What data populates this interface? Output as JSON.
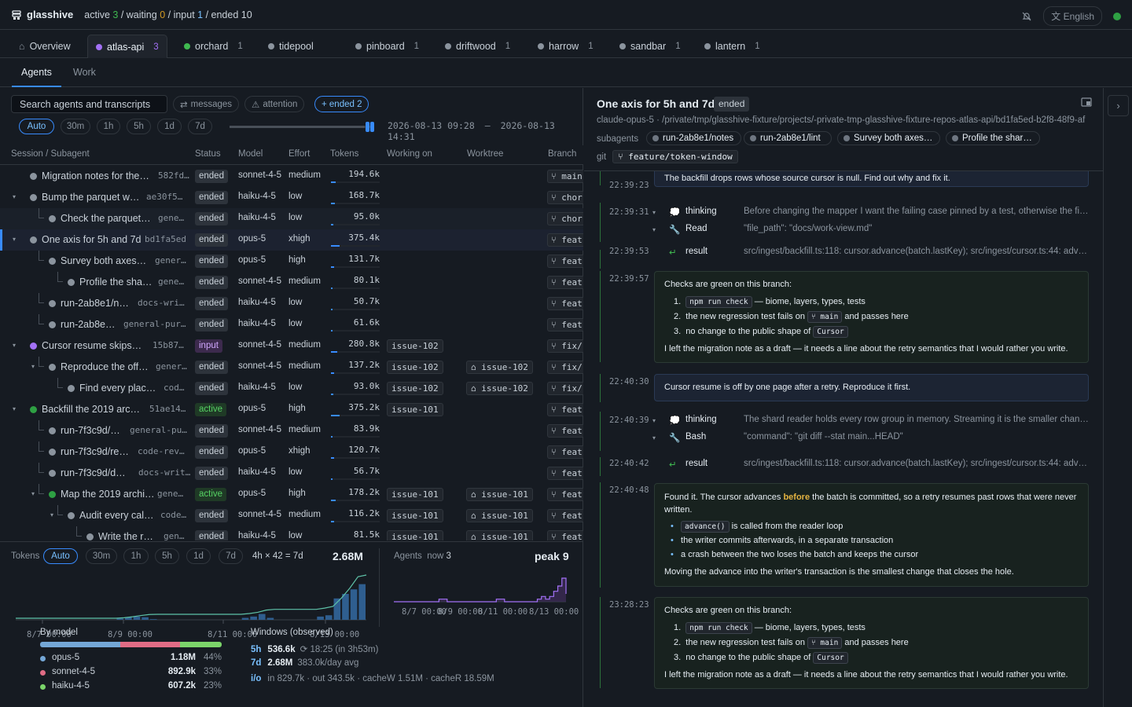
{
  "app": {
    "name": "glasshive"
  },
  "status_counts": {
    "active_label": "active",
    "active": "3",
    "waiting_label": "waiting",
    "waiting": "0",
    "input_label": "input",
    "input": "1",
    "ended_label": "ended",
    "ended": "10"
  },
  "language": "English",
  "projects": [
    {
      "name": "Overview",
      "count": "",
      "icon": "home-icon"
    },
    {
      "name": "atlas-api",
      "count": "3"
    },
    {
      "name": "orchard",
      "count": "1"
    },
    {
      "name": "tidepool",
      "count": ""
    },
    {
      "name": "pinboard",
      "count": "1"
    },
    {
      "name": "driftwood",
      "count": "1"
    },
    {
      "name": "harrow",
      "count": "1"
    },
    {
      "name": "sandbar",
      "count": "1"
    },
    {
      "name": "lantern",
      "count": "1"
    }
  ],
  "subtabs": [
    "Agents",
    "Work"
  ],
  "filters": {
    "search_placeholder": "Search agents and transcripts",
    "messages": "messages",
    "attention": "attention",
    "ended": "+ ended 2"
  },
  "ranges": [
    "Auto",
    "30m",
    "1h",
    "5h",
    "1d",
    "7d"
  ],
  "range_text": {
    "start": "2026-08-13 09:28",
    "sep": "–",
    "end": "2026-08-13 14:31"
  },
  "columns": [
    "Session / Subagent",
    "Status",
    "Model",
    "Effort",
    "Tokens",
    "Working on",
    "Worktree",
    "Branch"
  ],
  "rows": [
    {
      "name": "Migration notes for the…",
      "id": "582fd…",
      "status": "ended",
      "model": "sonnet-4-5",
      "effort": "medium",
      "tokens": "194.6k",
      "tfrac": 0.09,
      "issue": "",
      "worktree": "",
      "branch": "main"
    },
    {
      "name": "Bump the parquet w…",
      "id": "ae30f5…",
      "status": "ended",
      "model": "haiku-4-5",
      "effort": "low",
      "tokens": "168.7k",
      "tfrac": 0.08,
      "issue": "",
      "worktree": "",
      "branch": "chor"
    },
    {
      "name": "Check the parquet…",
      "id": "gene…",
      "status": "ended",
      "model": "haiku-4-5",
      "effort": "low",
      "tokens": "95.0k",
      "tfrac": 0.05,
      "issue": "",
      "worktree": "",
      "branch": "chor"
    },
    {
      "name": "One axis for 5h and 7d",
      "id": "bd1fa5ed",
      "status": "ended",
      "model": "opus-5",
      "effort": "xhigh",
      "tokens": "375.4k",
      "tfrac": 0.18,
      "issue": "",
      "worktree": "",
      "branch": "feat"
    },
    {
      "name": "Survey both axes…",
      "id": "gener…",
      "status": "ended",
      "model": "opus-5",
      "effort": "high",
      "tokens": "131.7k",
      "tfrac": 0.06,
      "issue": "",
      "worktree": "",
      "branch": "feat"
    },
    {
      "name": "Profile the sha…",
      "id": "gene…",
      "status": "ended",
      "model": "sonnet-4-5",
      "effort": "medium",
      "tokens": "80.1k",
      "tfrac": 0.04,
      "issue": "",
      "worktree": "",
      "branch": "feat"
    },
    {
      "name": "run-2ab8e1/n…",
      "id": "docs-wri…",
      "status": "ended",
      "model": "haiku-4-5",
      "effort": "low",
      "tokens": "50.7k",
      "tfrac": 0.03,
      "issue": "",
      "worktree": "",
      "branch": "feat"
    },
    {
      "name": "run-2ab8e…",
      "id": "general-pur…",
      "status": "ended",
      "model": "haiku-4-5",
      "effort": "low",
      "tokens": "61.6k",
      "tfrac": 0.03,
      "issue": "",
      "worktree": "",
      "branch": "feat"
    },
    {
      "name": "Cursor resume skips…",
      "id": "15b87…",
      "status": "input",
      "model": "sonnet-4-5",
      "effort": "medium",
      "tokens": "280.8k",
      "tfrac": 0.13,
      "issue": "issue-102",
      "worktree": "",
      "branch": "fix/"
    },
    {
      "name": "Reproduce the off…",
      "id": "gener…",
      "status": "ended",
      "model": "sonnet-4-5",
      "effort": "medium",
      "tokens": "137.2k",
      "tfrac": 0.07,
      "issue": "issue-102",
      "worktree": "issue-102",
      "branch": "fix/"
    },
    {
      "name": "Find every plac…",
      "id": "cod…",
      "status": "ended",
      "model": "haiku-4-5",
      "effort": "low",
      "tokens": "93.0k",
      "tfrac": 0.05,
      "issue": "issue-102",
      "worktree": "issue-102",
      "branch": "fix/"
    },
    {
      "name": "Backfill the 2019 arc…",
      "id": "51ae14…",
      "status": "active",
      "model": "opus-5",
      "effort": "high",
      "tokens": "375.2k",
      "tfrac": 0.18,
      "issue": "issue-101",
      "worktree": "",
      "branch": "feat"
    },
    {
      "name": "run-7f3c9d/…",
      "id": "general-pu…",
      "status": "ended",
      "model": "sonnet-4-5",
      "effort": "medium",
      "tokens": "83.9k",
      "tfrac": 0.04,
      "issue": "",
      "worktree": "",
      "branch": "feat"
    },
    {
      "name": "run-7f3c9d/re…",
      "id": "code-rev…",
      "status": "ended",
      "model": "opus-5",
      "effort": "xhigh",
      "tokens": "120.7k",
      "tfrac": 0.06,
      "issue": "",
      "worktree": "",
      "branch": "feat"
    },
    {
      "name": "run-7f3c9d/d…",
      "id": "docs-writ…",
      "status": "ended",
      "model": "haiku-4-5",
      "effort": "low",
      "tokens": "56.7k",
      "tfrac": 0.03,
      "issue": "",
      "worktree": "",
      "branch": "feat"
    },
    {
      "name": "Map the 2019 archi…",
      "id": "gene…",
      "status": "active",
      "model": "opus-5",
      "effort": "high",
      "tokens": "178.2k",
      "tfrac": 0.09,
      "issue": "issue-101",
      "worktree": "issue-101",
      "branch": "feat"
    },
    {
      "name": "Audit every cal…",
      "id": "code…",
      "status": "ended",
      "model": "sonnet-4-5",
      "effort": "medium",
      "tokens": "116.2k",
      "tfrac": 0.06,
      "issue": "issue-101",
      "worktree": "issue-101",
      "branch": "feat"
    },
    {
      "name": "Write the r…",
      "id": "gen…",
      "status": "ended",
      "model": "haiku-4-5",
      "effort": "low",
      "tokens": "81.5k",
      "tfrac": 0.04,
      "issue": "issue-101",
      "worktree": "issue-101",
      "branch": "feat"
    }
  ],
  "tokens_panel": {
    "label": "Tokens",
    "ranges": [
      "Auto",
      "30m",
      "1h",
      "5h",
      "1d",
      "7d"
    ],
    "bucket": "4h × 42 = 7d",
    "total": "2.68M",
    "ticks": [
      "8/7 00:00",
      "8/9 00:00",
      "8/11 00:00",
      "8/13 00:00"
    ]
  },
  "agents_panel": {
    "label": "Agents",
    "now_label": "now",
    "now": "3",
    "peak_label": "peak",
    "peak": "9",
    "ticks": [
      "8/7 00:00",
      "8/9 00:00",
      "8/11 00:00",
      "8/13 00:00"
    ]
  },
  "by_model": {
    "title": "By model",
    "models": [
      {
        "name": "opus-5",
        "tokens": "1.18M",
        "pct": "44%",
        "frac": 0.44,
        "color": "#74a7d6"
      },
      {
        "name": "sonnet-4-5",
        "tokens": "892.9k",
        "pct": "33%",
        "frac": 0.33,
        "color": "#e06c85"
      },
      {
        "name": "haiku-4-5",
        "tokens": "607.2k",
        "pct": "23%",
        "frac": 0.23,
        "color": "#7bd46a"
      }
    ]
  },
  "windows": {
    "title": "Windows (observed)",
    "w5h_label": "5h",
    "w5h_value": "536.6k",
    "w5h_reset": "18:25 (in 3h53m)",
    "w7d_label": "7d",
    "w7d_value": "2.68M",
    "w7d_avg": "383.0k/day avg",
    "io_label": "i/o",
    "io_text": "in 829.7k · out 343.5k · cacheW 1.51M · cacheR 18.59M"
  },
  "detail": {
    "title": "One axis for 5h and 7d",
    "status": "ended",
    "model": "claude-opus-5",
    "path": "/private/tmp/glasshive-fixture/projects/-private-tmp-glasshive-fixture-repos-atlas-api/bd1fa5ed-b2f8-48f9-af",
    "subagents_label": "subagents",
    "subagents": [
      "run-2ab8e1/notes",
      "run-2ab8e1/lint",
      "Survey both axes…",
      "Profile the shar…"
    ],
    "git_label": "git",
    "branch": "feature/token-window"
  },
  "transcript": {
    "m1": {
      "time": "22:39:23",
      "text": "The backfill drops rows whose source cursor is null. Find out why and fix it."
    },
    "e1": {
      "time": "22:39:31",
      "thinking_label": "thinking",
      "thinking": "Before changing the mapper I want the failing case pinned by a test, otherwise the fi…",
      "tool": "Read",
      "tool_args": "\"file_path\": \"docs/work-view.md\""
    },
    "r1": {
      "time": "22:39:53",
      "label": "result",
      "text": "src/ingest/backfill.ts:118: cursor.advance(batch.lastKey); src/ingest/cursor.ts:44: adv…"
    },
    "c1": {
      "time": "22:39:57",
      "intro": "Checks are green on this branch:",
      "i1_code": "npm run check",
      "i1_text": "— biome, layers, types, tests",
      "i2_text": "the new regression test fails on",
      "i2_code": "main",
      "i2_tail": "and passes here",
      "i3_text": "no change to the public shape of",
      "i3_code": "Cursor",
      "outro": "I left the migration note as a draft — it needs a line about the retry semantics that I would rather you write."
    },
    "m2": {
      "time": "22:40:30",
      "text": "Cursor resume is off by one page after a retry. Reproduce it first."
    },
    "e2": {
      "time": "22:40:39",
      "thinking_label": "thinking",
      "thinking": "The shard reader holds every row group in memory. Streaming it is the smaller chan…",
      "tool": "Bash",
      "tool_args": "\"command\": \"git diff --stat main...HEAD\""
    },
    "r2": {
      "time": "22:40:42",
      "label": "result",
      "text": "src/ingest/backfill.ts:118: cursor.advance(batch.lastKey); src/ingest/cursor.ts:44: adv…"
    },
    "c2": {
      "time": "22:40:48",
      "l1a": "Found it. The cursor advances",
      "l1b": "before",
      "l1c": "the batch is committed, so a retry resumes past rows that were never",
      "l2": "written.",
      "b1_code": "advance()",
      "b1_text": "is called from the reader loop",
      "b2": "the writer commits afterwards, in a separate transaction",
      "b3": "a crash between the two loses the batch and keeps the cursor",
      "outro": "Moving the advance into the writer's transaction is the smallest change that closes the hole."
    },
    "c3": {
      "time": "23:28:23",
      "intro": "Checks are green on this branch:",
      "i1_code": "npm run check",
      "i1_text": "— biome, layers, types, tests",
      "i2_text": "the new regression test fails on",
      "i2_code": "main",
      "i2_tail": "and passes here",
      "i3_text": "no change to the public shape of",
      "i3_code": "Cursor",
      "outro": "I left the migration note as a draft — it needs a line about the retry semantics that I would rather you write."
    }
  },
  "chart_data": [
    {
      "type": "bar",
      "title": "Tokens",
      "x": [
        "8/7 00:00",
        "8/9 00:00",
        "8/11 00:00",
        "8/13 00:00"
      ],
      "values_4h": [
        0,
        0,
        0,
        0,
        0,
        0,
        0,
        0,
        0,
        0,
        0,
        0,
        0.02,
        0.04,
        0.05,
        0.04,
        0.01,
        0,
        0,
        0,
        0,
        0,
        0,
        0,
        0,
        0,
        0,
        0.03,
        0.05,
        0.09,
        0.03,
        0,
        0,
        0,
        0,
        0,
        0.05,
        0.07,
        0.33,
        0.4,
        0.47,
        0.55
      ],
      "unit": "relative"
    },
    {
      "type": "line",
      "title": "Agents",
      "x": [
        "8/7 00:00",
        "8/9 00:00",
        "8/11 00:00",
        "8/13 00:00"
      ],
      "now": 3,
      "peak": 9,
      "values": [
        0,
        0,
        0,
        0,
        0,
        0,
        0,
        0,
        0,
        0,
        0,
        1,
        1,
        0,
        0,
        0,
        0,
        0,
        0,
        0,
        0,
        0,
        0,
        0,
        0,
        1,
        1,
        0,
        0,
        0,
        0,
        0,
        0,
        0,
        0,
        1,
        2,
        1,
        2,
        4,
        6,
        9,
        3
      ]
    }
  ]
}
